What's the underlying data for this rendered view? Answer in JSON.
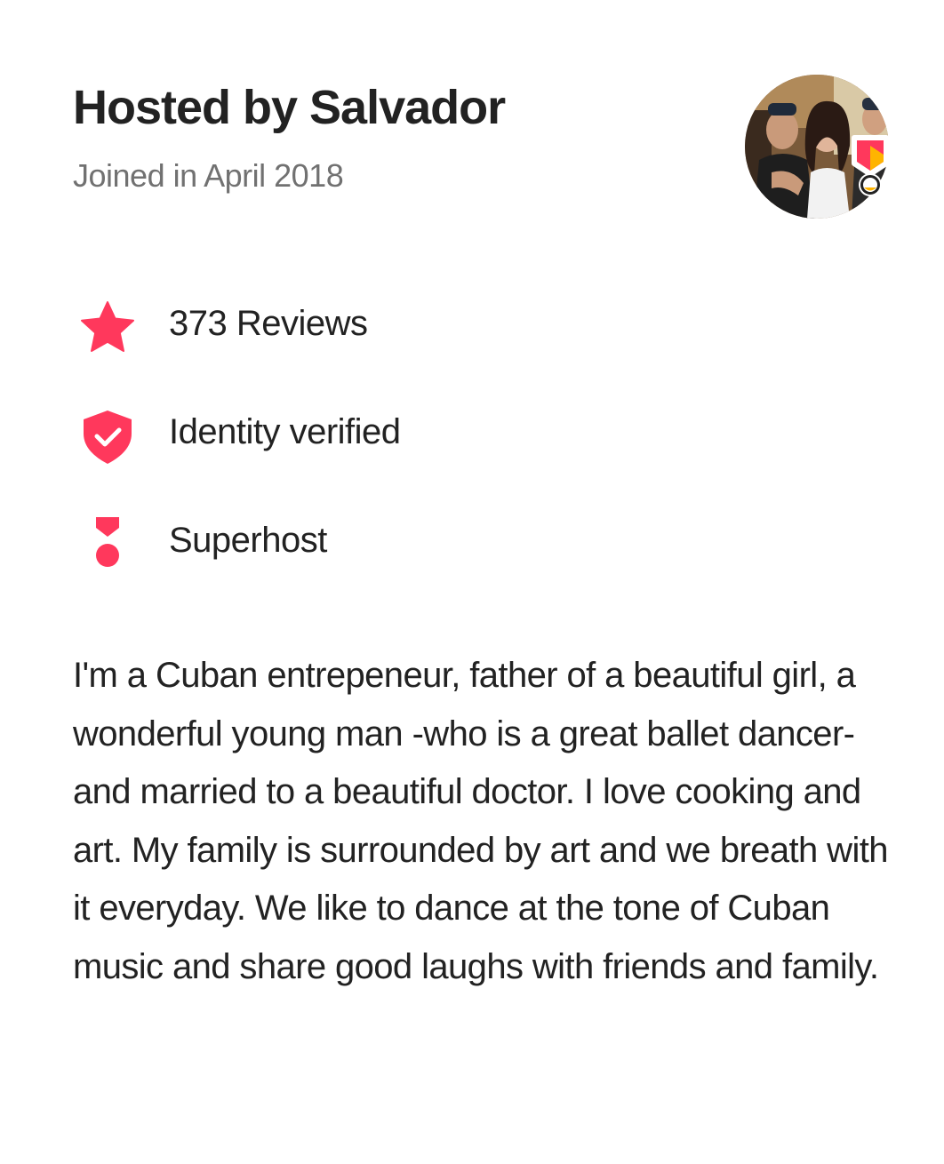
{
  "host": {
    "title": "Hosted by Salvador",
    "joined": "Joined in April 2018"
  },
  "facts": [
    {
      "icon": "star-icon",
      "label": "373 Reviews"
    },
    {
      "icon": "shield-check-icon",
      "label": "Identity verified"
    },
    {
      "icon": "superhost-medal-icon",
      "label": "Superhost"
    }
  ],
  "bio": "I'm a Cuban entrepeneur, father of a beautiful girl, a wonderful young man -who is a great ballet dancer- and married to a beautiful doctor. I love cooking and art. My family is surrounded by art and we breath with it everyday. We like to dance at the tone of Cuban music and share good laughs with friends and family.",
  "colors": {
    "accent": "#FF385C",
    "text_primary": "#222222",
    "text_secondary": "#717171",
    "background": "#FFFFFF"
  }
}
